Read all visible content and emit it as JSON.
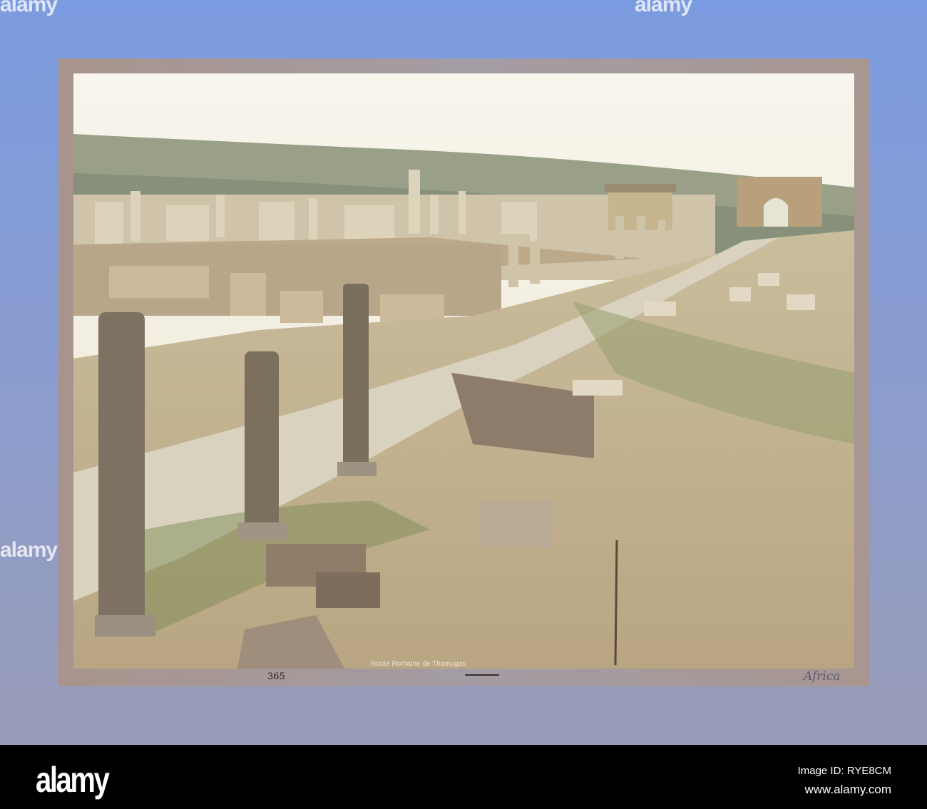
{
  "watermark": "alamy",
  "photo": {
    "caption": "Route Romaine de Thamugas",
    "plate_number": "365",
    "annotation": "Africa"
  },
  "footer": {
    "logo": "alamy",
    "image_id": "Image ID: RYE8CM",
    "url": "www.alamy.com"
  }
}
